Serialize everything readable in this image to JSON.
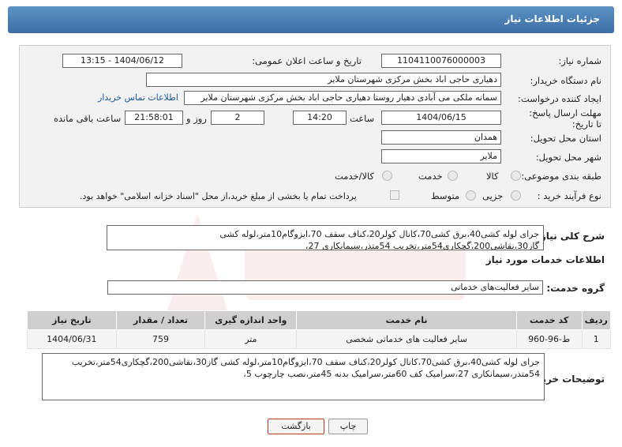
{
  "page_title": "جزئیات اطلاعات نیاز",
  "form": {
    "need_number_label": "شماره نیاز:",
    "need_number": "1104110076000003",
    "announce_label": "تاریخ و ساعت اعلان عمومی:",
    "announce_value": "1404/06/12 - 13:15",
    "buyer_org_label": "نام دستگاه خریدار:",
    "buyer_org": "دهیاری حاجی اباد بخش مرکزی شهرستان ملایر",
    "creator_label": "ایجاد کننده درخواست:",
    "creator": "سمانه ملکی می آبادی دهیار روستا  دهیاری حاجی اباد بخش مرکزی شهرستان ملایر",
    "contact_link": "اطلاعات تماس خریدار",
    "deadline_label": "مهلت ارسال پاسخ: تا تاریخ:",
    "deadline_date": "1404/06/15",
    "time_label": "ساعت",
    "deadline_time": "14:20",
    "days_value": "2",
    "days_label": "روز و",
    "remaining_time": "21:58:01",
    "remaining_label": "ساعت باقی مانده",
    "province_label": "استان محل تحویل:",
    "province": "همدان",
    "city_label": "شهر محل تحویل:",
    "city": "ملایر",
    "category_label": "طبقه بندی موضوعی:",
    "category_options": [
      "کالا",
      "خدمت",
      "کالا/خدمت"
    ],
    "process_label": "نوع فرآیند خرید :",
    "process_options": [
      "جزیی",
      "متوسط"
    ],
    "payment_note": "پرداخت تمام یا بخشی از مبلغ خرید،از محل \"اسناد خزانه اسلامی\" خواهد بود."
  },
  "description": {
    "label": "شرح کلی نیاز:",
    "text": "جرای لوله کشی40،برق کشی70،کانال کولر20،کناف سقف 70،ایزوگام10متر،لوله کشی گاز30،نقاشی200،گچکاری54متر،تخریب 54متذر،سیمانکاری 27،"
  },
  "services": {
    "section_title": "اطلاعات خدمات مورد نیاز",
    "group_label": "گروه خدمت:",
    "group_value": "سایر فعالیت‌های خدماتی",
    "columns": [
      "ردیف",
      "کد خدمت",
      "نام خدمت",
      "واحد اندازه گیری",
      "تعداد / مقدار",
      "تاریخ نیاز"
    ],
    "rows": [
      [
        "1",
        "ط-96-960",
        "سایر فعالیت های خدماتی شخصی",
        "متر",
        "759",
        "1404/06/31"
      ]
    ]
  },
  "buyer_notes": {
    "label": "توضیحات خریدار:",
    "text": "جرای لوله کشی40،برق کشی70،کانال کولر20،کناف سقف 70،ایزوگام10متر،لوله کشی گاز30،نقاشی200،گچکاری54متر،تخریب 54متذر،سیمانکاری 27،سرامیک کف 60متر،سرامیک بدنه 45متر،نصب چارچوب 5،"
  },
  "buttons": {
    "print": "چاپ",
    "back": "بازگشت"
  },
  "colors": {
    "header": "#3a6ea5",
    "link": "#1a5aa0",
    "back_border": "#c0392b"
  }
}
